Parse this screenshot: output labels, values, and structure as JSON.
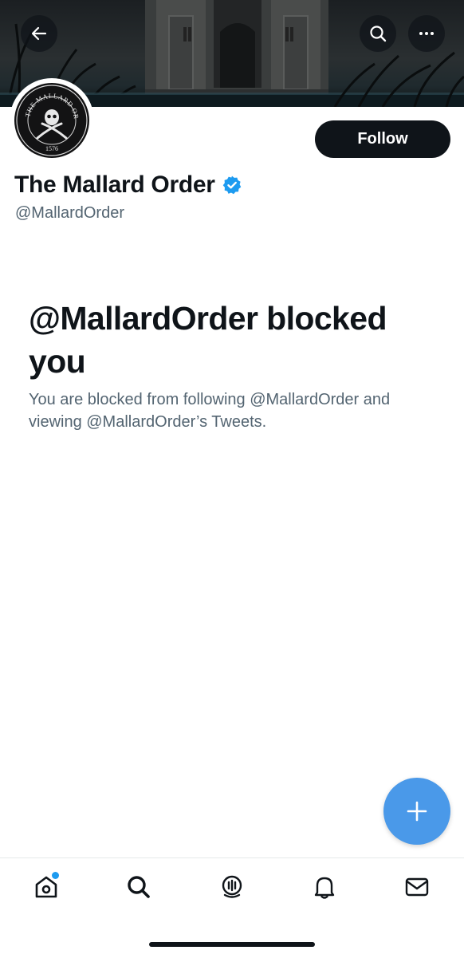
{
  "header": {
    "back_icon": "arrow-left-icon",
    "search_icon": "search-icon",
    "more_icon": "more-horizontal-icon"
  },
  "profile": {
    "avatar_logo_text": "THE MALLARD ORDER",
    "avatar_logo_year": "1576",
    "follow_label": "Follow",
    "display_name": "The Mallard Order",
    "verified": true,
    "handle": "@MallardOrder"
  },
  "blocked": {
    "title": "@MallardOrder blocked you",
    "description": "You are blocked from following @MallardOrder and viewing @MallardOrder’s Tweets."
  },
  "fab": {
    "icon": "plus-icon"
  },
  "bottom_nav": {
    "items": [
      {
        "icon": "home-icon",
        "has_unread_dot": true
      },
      {
        "icon": "search-icon"
      },
      {
        "icon": "spaces-icon"
      },
      {
        "icon": "bell-icon"
      },
      {
        "icon": "mail-icon"
      }
    ]
  },
  "colors": {
    "accent": "#1d9bf0",
    "fab": "#4a99e9",
    "primary_text": "#0f1419",
    "secondary_text": "#536471",
    "follow_button_bg": "#0f1419"
  }
}
